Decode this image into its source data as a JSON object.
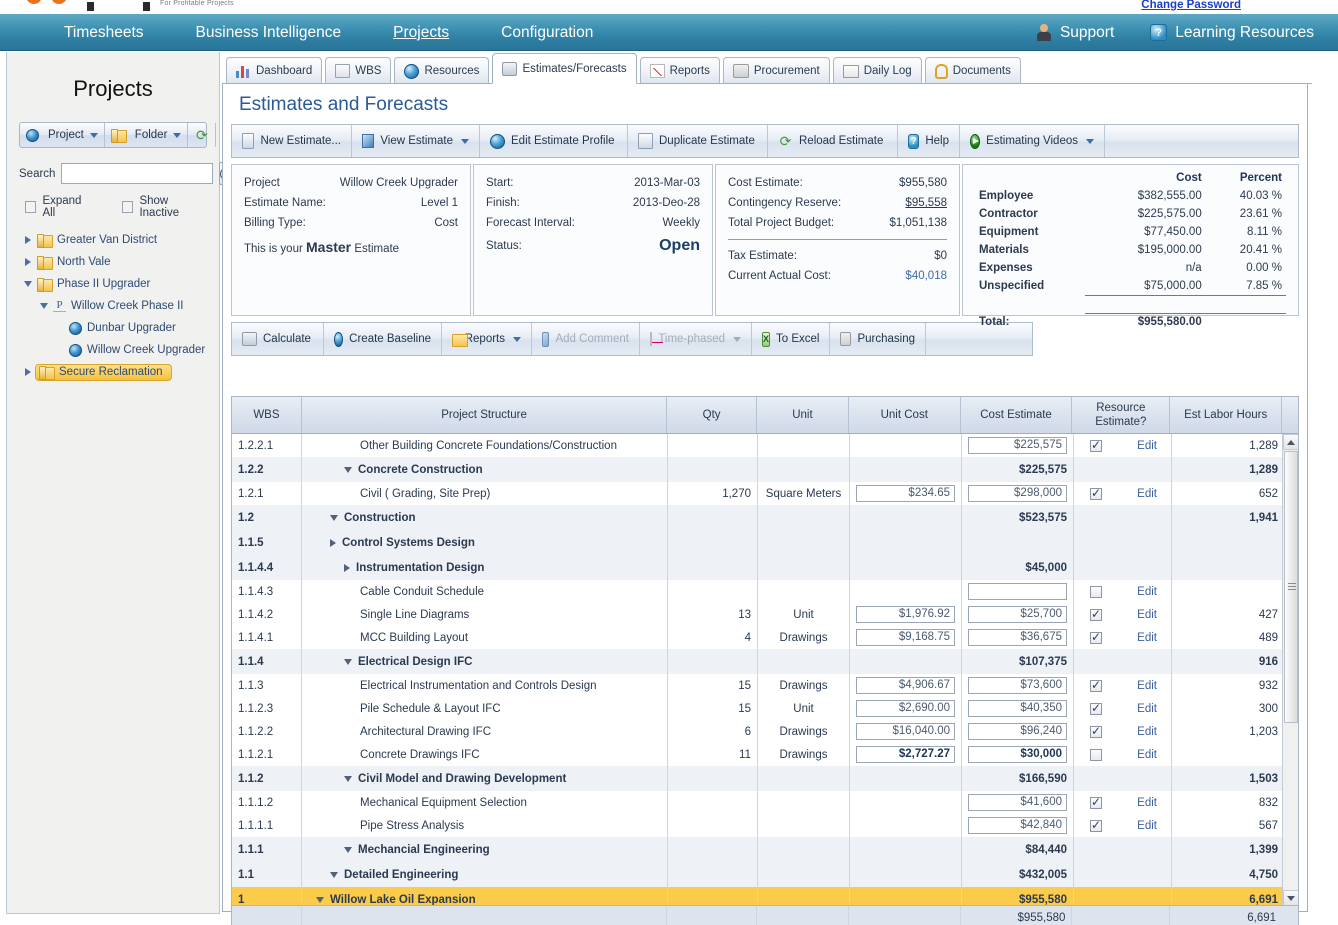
{
  "logo": {
    "tagline": "For Profitable Projects"
  },
  "header": {
    "change_password": "Change Password",
    "nav": [
      {
        "label": "Timesheets",
        "active": false
      },
      {
        "label": "Business Intelligence",
        "active": false
      },
      {
        "label": "Projects",
        "active": true
      },
      {
        "label": "Configuration",
        "active": false
      }
    ],
    "right": [
      {
        "label": "Support",
        "icon": "support-icon"
      },
      {
        "label": "Learning Resources",
        "icon": "learning-resources-icon"
      }
    ]
  },
  "sidebar": {
    "title": "Projects",
    "toolbar": [
      {
        "label": "Project",
        "icon": "globe-icon",
        "caret": true
      },
      {
        "label": "Folder",
        "icon": "folder-icon",
        "caret": true
      },
      {
        "label": "",
        "icon": "refresh-icon",
        "caret": false
      }
    ],
    "search": {
      "label": "Search",
      "value": "",
      "placeholder": ""
    },
    "checkboxes": [
      {
        "label": "Expand All",
        "checked": false
      },
      {
        "label": "Show Inactive",
        "checked": false
      }
    ],
    "tree": [
      {
        "label": "Greater Van District",
        "icon": "folder-icon",
        "state": "collapsed",
        "indent": 0,
        "selected": false
      },
      {
        "label": "North Vale",
        "icon": "folder-icon",
        "state": "collapsed",
        "indent": 0,
        "selected": false
      },
      {
        "label": "Phase II Upgrader",
        "icon": "folder-icon",
        "state": "expanded",
        "indent": 0,
        "selected": false
      },
      {
        "label": "Willow Creek Phase II",
        "icon": "program-icon",
        "state": "expanded",
        "indent": 1,
        "selected": false
      },
      {
        "label": "Dunbar Upgrader",
        "icon": "globe-icon",
        "state": "leaf",
        "indent": 2,
        "selected": false
      },
      {
        "label": "Willow Creek Upgrader",
        "icon": "globe-icon",
        "state": "leaf",
        "indent": 2,
        "selected": false
      },
      {
        "label": "Secure Reclamation",
        "icon": "folder-icon",
        "state": "collapsed",
        "indent": 0,
        "selected": true
      }
    ]
  },
  "tabs": [
    {
      "label": "Dashboard",
      "icon": "bar-chart-icon",
      "active": false
    },
    {
      "label": "WBS",
      "icon": "tree-icon",
      "active": false
    },
    {
      "label": "Resources",
      "icon": "people-globe-icon",
      "active": false
    },
    {
      "label": "Estimates/Forecasts",
      "icon": "calculator-icon",
      "active": true
    },
    {
      "label": "Reports",
      "icon": "line-chart-icon",
      "active": false
    },
    {
      "label": "Procurement",
      "icon": "cart-icon",
      "active": false
    },
    {
      "label": "Daily Log",
      "icon": "book-icon",
      "active": false
    },
    {
      "label": "Documents",
      "icon": "paperclip-icon",
      "active": false
    }
  ],
  "page": {
    "title": "Estimates and Forecasts"
  },
  "estimate_toolbar": [
    {
      "label": "New Estimate...",
      "icon": "new-document-icon",
      "caret": false,
      "disabled": false
    },
    {
      "label": "View Estimate",
      "icon": "view-icon",
      "caret": true,
      "disabled": false
    },
    {
      "label": "Edit Estimate Profile",
      "icon": "edit-profile-icon",
      "caret": false,
      "disabled": false
    },
    {
      "label": "Duplicate Estimate",
      "icon": "duplicate-icon",
      "caret": false,
      "disabled": false
    },
    {
      "label": "Reload Estimate",
      "icon": "reload-icon",
      "caret": false,
      "disabled": false
    },
    {
      "label": "Help",
      "icon": "help-icon",
      "caret": false,
      "disabled": false
    },
    {
      "label": "Estimating Videos",
      "icon": "play-icon",
      "caret": true,
      "disabled": false
    }
  ],
  "info": {
    "card1": [
      {
        "k": "Project",
        "v": "Willow Creek Upgrader"
      },
      {
        "k": "Estimate Name:",
        "v": "Level 1"
      },
      {
        "k": "Billing Type:",
        "v": "Cost"
      }
    ],
    "master_prefix": "This is your ",
    "master_word": "Master",
    "master_suffix": " Estimate",
    "card2": [
      {
        "k": "Start:",
        "v": "2013-Mar-03"
      },
      {
        "k": "Finish:",
        "v": "2013-Deo-28"
      },
      {
        "k": "Forecast Interval:",
        "v": "Weekly"
      },
      {
        "k": "Status:",
        "v": "Open",
        "big": true
      }
    ],
    "card3_top": [
      {
        "k": "Cost Estimate:",
        "v": "$955,580"
      },
      {
        "k": "Contingency Reserve:",
        "v": "$95,558",
        "underline": true
      },
      {
        "k": "Total Project Budget:",
        "v": "$1,051,138"
      }
    ],
    "card3_bottom": [
      {
        "k": "Tax Estimate:",
        "v": "$0"
      },
      {
        "k": "Current Actual Cost:",
        "v": "$40,018",
        "blue": true
      }
    ],
    "breakdown": {
      "headers": [
        "",
        "Cost",
        "Percent"
      ],
      "rows": [
        {
          "label": "Employee",
          "cost": "$382,555.00",
          "percent": "40.03 %"
        },
        {
          "label": "Contractor",
          "cost": "$225,575.00",
          "percent": "23.61 %"
        },
        {
          "label": "Equipment",
          "cost": "$77,450.00",
          "percent": "8.11 %"
        },
        {
          "label": "Materials",
          "cost": "$195,000.00",
          "percent": "20.41 %"
        },
        {
          "label": "Expenses",
          "cost": "n/a",
          "percent": "0.00 %"
        },
        {
          "label": "Unspecified",
          "cost": "$75,000.00",
          "percent": "7.85 %"
        }
      ],
      "total": {
        "label": "Total:",
        "cost": "$955,580.00",
        "percent": ""
      }
    }
  },
  "grid_toolbar": [
    {
      "label": "Calculate",
      "icon": "calculator-icon",
      "caret": false,
      "disabled": false
    },
    {
      "label": "Create Baseline",
      "icon": "baseline-icon",
      "caret": false,
      "disabled": false
    },
    {
      "label": "Reports",
      "icon": "reports-folder-icon",
      "caret": true,
      "disabled": false
    },
    {
      "label": "Add Comment",
      "icon": "comment-pencil-icon",
      "caret": false,
      "disabled": true
    },
    {
      "label": "Time-phased",
      "icon": "time-phased-icon",
      "caret": true,
      "disabled": true
    },
    {
      "label": "To Excel",
      "icon": "excel-icon",
      "caret": false,
      "disabled": false
    },
    {
      "label": "Purchasing",
      "icon": "purchasing-cart-icon",
      "caret": false,
      "disabled": false
    }
  ],
  "grid": {
    "columns": [
      "WBS",
      "Project Structure",
      "Qty",
      "Unit",
      "Unit Cost",
      "Cost Estimate",
      "Resource Estimate?",
      "Est Labor Hours"
    ],
    "column_resource_line1": "Resource",
    "column_resource_line2": "Estimate?",
    "rows": [
      {
        "wbs": "1",
        "name": "Willow Lake Oil Expansion",
        "indent": 0,
        "twisty": "down",
        "qty": "",
        "unit": "",
        "unit_cost": "",
        "unit_cost_input": false,
        "cost": "$955,580",
        "cost_input": false,
        "resource": null,
        "edit": false,
        "hours": "6,691",
        "style": "top"
      },
      {
        "wbs": "1.1",
        "name": "Detailed Engineering",
        "indent": 1,
        "twisty": "down",
        "qty": "",
        "unit": "",
        "unit_cost": "",
        "unit_cost_input": false,
        "cost": "$432,005",
        "cost_input": false,
        "resource": null,
        "edit": false,
        "hours": "4,750",
        "style": "summary"
      },
      {
        "wbs": "1.1.1",
        "name": "Mechancial Engineering",
        "indent": 2,
        "twisty": "down",
        "qty": "",
        "unit": "",
        "unit_cost": "",
        "unit_cost_input": false,
        "cost": "$84,440",
        "cost_input": false,
        "resource": null,
        "edit": false,
        "hours": "1,399",
        "style": "summary"
      },
      {
        "wbs": "1.1.1.1",
        "name": "Pipe Stress Analysis",
        "indent": 3,
        "twisty": "none",
        "qty": "",
        "unit": "",
        "unit_cost": "",
        "unit_cost_input": false,
        "cost": "$42,840",
        "cost_input": true,
        "resource": true,
        "edit": true,
        "hours": "567",
        "style": "normal"
      },
      {
        "wbs": "1.1.1.2",
        "name": "Mechanical Equipment Selection",
        "indent": 3,
        "twisty": "none",
        "qty": "",
        "unit": "",
        "unit_cost": "",
        "unit_cost_input": false,
        "cost": "$41,600",
        "cost_input": true,
        "resource": true,
        "edit": true,
        "hours": "832",
        "style": "normal"
      },
      {
        "wbs": "1.1.2",
        "name": "Civil Model and Drawing Development",
        "indent": 2,
        "twisty": "down",
        "qty": "",
        "unit": "",
        "unit_cost": "",
        "unit_cost_input": false,
        "cost": "$166,590",
        "cost_input": false,
        "resource": null,
        "edit": false,
        "hours": "1,503",
        "style": "summary"
      },
      {
        "wbs": "1.1.2.1",
        "name": "Concrete Drawings IFC",
        "indent": 3,
        "twisty": "none",
        "qty": "11",
        "unit": "Drawings",
        "unit_cost": "$2,727.27",
        "unit_cost_input": true,
        "unit_cost_focus": true,
        "cost": "$30,000",
        "cost_input": true,
        "cost_focus": true,
        "resource": false,
        "edit": true,
        "hours": "",
        "style": "normal"
      },
      {
        "wbs": "1.1.2.2",
        "name": "Architectural Drawing IFC",
        "indent": 3,
        "twisty": "none",
        "qty": "6",
        "unit": "Drawings",
        "unit_cost": "$16,040.00",
        "unit_cost_input": true,
        "cost": "$96,240",
        "cost_input": true,
        "resource": true,
        "edit": true,
        "hours": "1,203",
        "style": "normal"
      },
      {
        "wbs": "1.1.2.3",
        "name": "Pile Schedule & Layout IFC",
        "indent": 3,
        "twisty": "none",
        "qty": "15",
        "unit": "Unit",
        "unit_cost": "$2,690.00",
        "unit_cost_input": true,
        "cost": "$40,350",
        "cost_input": true,
        "resource": true,
        "edit": true,
        "hours": "300",
        "style": "normal"
      },
      {
        "wbs": "1.1.3",
        "name": "Electrical Instrumentation and Controls Design",
        "indent": 3,
        "twisty": "none",
        "qty": "15",
        "unit": "Drawings",
        "unit_cost": "$4,906.67",
        "unit_cost_input": true,
        "cost": "$73,600",
        "cost_input": true,
        "resource": true,
        "edit": true,
        "hours": "932",
        "style": "normal"
      },
      {
        "wbs": "1.1.4",
        "name": "Electrical Design IFC",
        "indent": 2,
        "twisty": "down",
        "qty": "",
        "unit": "",
        "unit_cost": "",
        "unit_cost_input": false,
        "cost": "$107,375",
        "cost_input": false,
        "resource": null,
        "edit": false,
        "hours": "916",
        "style": "summary"
      },
      {
        "wbs": "1.1.4.1",
        "name": "MCC Building Layout",
        "indent": 3,
        "twisty": "none",
        "qty": "4",
        "unit": "Drawings",
        "unit_cost": "$9,168.75",
        "unit_cost_input": true,
        "cost": "$36,675",
        "cost_input": true,
        "resource": true,
        "edit": true,
        "hours": "489",
        "style": "normal"
      },
      {
        "wbs": "1.1.4.2",
        "name": "Single Line Diagrams",
        "indent": 3,
        "twisty": "none",
        "qty": "13",
        "unit": "Unit",
        "unit_cost": "$1,976.92",
        "unit_cost_input": true,
        "cost": "$25,700",
        "cost_input": true,
        "resource": true,
        "edit": true,
        "hours": "427",
        "style": "normal"
      },
      {
        "wbs": "1.1.4.3",
        "name": "Cable Conduit Schedule",
        "indent": 3,
        "twisty": "none",
        "qty": "",
        "unit": "",
        "unit_cost": "",
        "unit_cost_input": false,
        "cost": "",
        "cost_input": true,
        "resource": false,
        "edit": true,
        "hours": "",
        "style": "normal"
      },
      {
        "wbs": "1.1.4.4",
        "name": "Instrumentation Design",
        "indent": 2,
        "twisty": "right",
        "qty": "",
        "unit": "",
        "unit_cost": "",
        "unit_cost_input": false,
        "cost": "$45,000",
        "cost_input": false,
        "resource": null,
        "edit": false,
        "hours": "",
        "style": "summary"
      },
      {
        "wbs": "1.1.5",
        "name": "Control Systems Design",
        "indent": 1,
        "twisty": "right",
        "qty": "",
        "unit": "",
        "unit_cost": "",
        "unit_cost_input": false,
        "cost": "",
        "cost_input": false,
        "resource": null,
        "edit": false,
        "hours": "",
        "style": "summary"
      },
      {
        "wbs": "1.2",
        "name": "Construction",
        "indent": 1,
        "twisty": "down",
        "qty": "",
        "unit": "",
        "unit_cost": "",
        "unit_cost_input": false,
        "cost": "$523,575",
        "cost_input": false,
        "resource": null,
        "edit": false,
        "hours": "1,941",
        "style": "summary"
      },
      {
        "wbs": "1.2.1",
        "name": "Civil ( Grading, Site Prep)",
        "indent": 3,
        "twisty": "none",
        "qty": "1,270",
        "unit": "Square Meters",
        "unit_cost": "$234.65",
        "unit_cost_input": true,
        "cost": "$298,000",
        "cost_input": true,
        "resource": true,
        "edit": true,
        "hours": "652",
        "style": "normal"
      },
      {
        "wbs": "1.2.2",
        "name": "Concrete Construction",
        "indent": 2,
        "twisty": "down",
        "qty": "",
        "unit": "",
        "unit_cost": "",
        "unit_cost_input": false,
        "cost": "$225,575",
        "cost_input": false,
        "resource": null,
        "edit": false,
        "hours": "1,289",
        "style": "summary"
      },
      {
        "wbs": "1.2.2.1",
        "name": "Other Building Concrete Foundations/Construction",
        "indent": 3,
        "twisty": "none",
        "qty": "",
        "unit": "",
        "unit_cost": "",
        "unit_cost_input": false,
        "cost": "$225,575",
        "cost_input": true,
        "resource": true,
        "edit": true,
        "hours": "1,289",
        "style": "normal"
      }
    ],
    "edit_label": "Edit",
    "footer": {
      "cost": "$955,580",
      "hours": "6,691"
    }
  }
}
